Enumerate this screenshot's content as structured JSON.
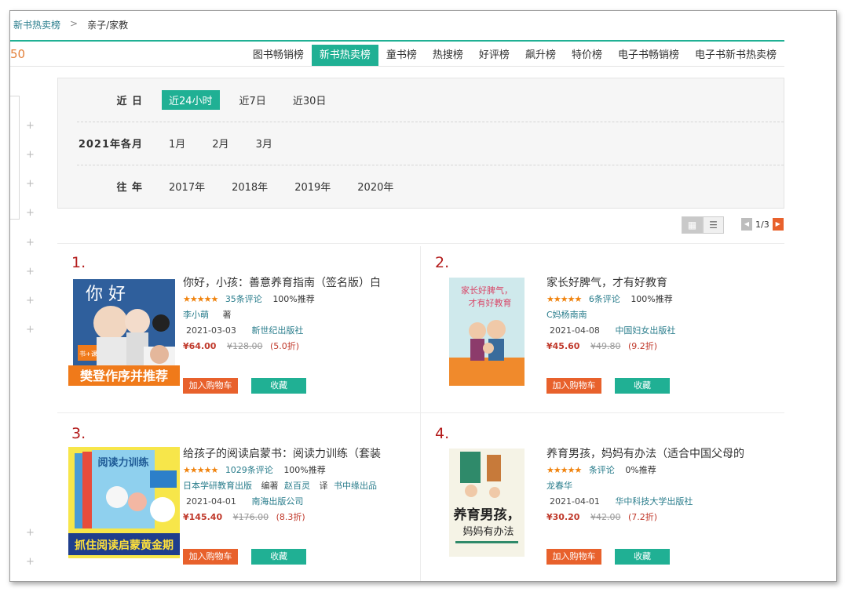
{
  "breadcrumb": {
    "parent": "新书热卖榜",
    "separator": ">",
    "current": "亲子/家教"
  },
  "tabs_stub": "50",
  "tabs": [
    "图书畅销榜",
    "新书热卖榜",
    "童书榜",
    "热搜榜",
    "好评榜",
    "飙升榜",
    "特价榜",
    "电子书畅销榜",
    "电子书新书热卖榜"
  ],
  "active_tab": "新书热卖榜",
  "filter": {
    "recent": {
      "label": "近 日",
      "options": [
        "近24小时",
        "近7日",
        "近30日"
      ],
      "active": "近24小时"
    },
    "months": {
      "label": "2021年各月",
      "options": [
        "1月",
        "2月",
        "3月"
      ]
    },
    "years": {
      "label": "往 年",
      "options": [
        "2017年",
        "2018年",
        "2019年",
        "2020年"
      ]
    }
  },
  "pager": {
    "text": "1/3"
  },
  "icons": {
    "grid": "grid-view-icon",
    "list": "list-view-icon",
    "prev": "arrow-left-icon",
    "next": "arrow-right-icon",
    "plus": "plus-icon"
  },
  "actions": {
    "cart": "加入购物车",
    "fav": "收藏"
  },
  "books": [
    {
      "rank": "1.",
      "title": "你好，小孩：善意养育指南（签名版）白",
      "stars": "★★★★★",
      "reviews": "35条评论",
      "recommend": "100%推荐",
      "author": "李小萌",
      "author_role": "著",
      "date": "2021-03-03",
      "publisher": "新世纪出版社",
      "price": "¥64.00",
      "old_price": "¥128.00",
      "discount": "(5.0折)",
      "cover_text": {
        "title": "你 好",
        "banner": "樊登作序并推荐",
        "badge": "书+课"
      }
    },
    {
      "rank": "2.",
      "title": "家长好脾气，才有好教育",
      "stars": "★★★★★",
      "reviews": "6条评论",
      "recommend": "100%推荐",
      "author": "C妈杨南南",
      "date": "2021-04-08",
      "publisher": "中国妇女出版社",
      "price": "¥45.60",
      "old_price": "¥49.80",
      "discount": "(9.2折)",
      "cover_text": {
        "title1": "家长好脾气，",
        "title2": "才有好教育"
      }
    },
    {
      "rank": "3.",
      "title": "给孩子的阅读启蒙书：阅读力训练（套装",
      "stars": "★★★★★",
      "reviews": "1029条评论",
      "recommend": "100%推荐",
      "author": "日本学研教育出版",
      "author_role": "编著",
      "editor": "赵百灵",
      "editor_role": "译",
      "editor2": "书中缘出品",
      "date": "2021-04-01",
      "publisher": "南海出版公司",
      "price": "¥145.40",
      "old_price": "¥176.00",
      "discount": "(8.3折)",
      "cover_text": {
        "title": "阅读力训练",
        "banner": "抓住阅读启蒙黄金期"
      }
    },
    {
      "rank": "4.",
      "title": "养育男孩，妈妈有办法（适合中国父母的",
      "stars": "★★★★★",
      "reviews": "条评论",
      "recommend": "0%推荐",
      "author": "龙春华",
      "date": "2021-04-01",
      "publisher": "华中科技大学出版社",
      "price": "¥30.20",
      "old_price": "¥42.00",
      "discount": "(7.2折)",
      "cover_text": {
        "title1": "养育男孩，",
        "title2": "妈妈有办法"
      }
    }
  ]
}
